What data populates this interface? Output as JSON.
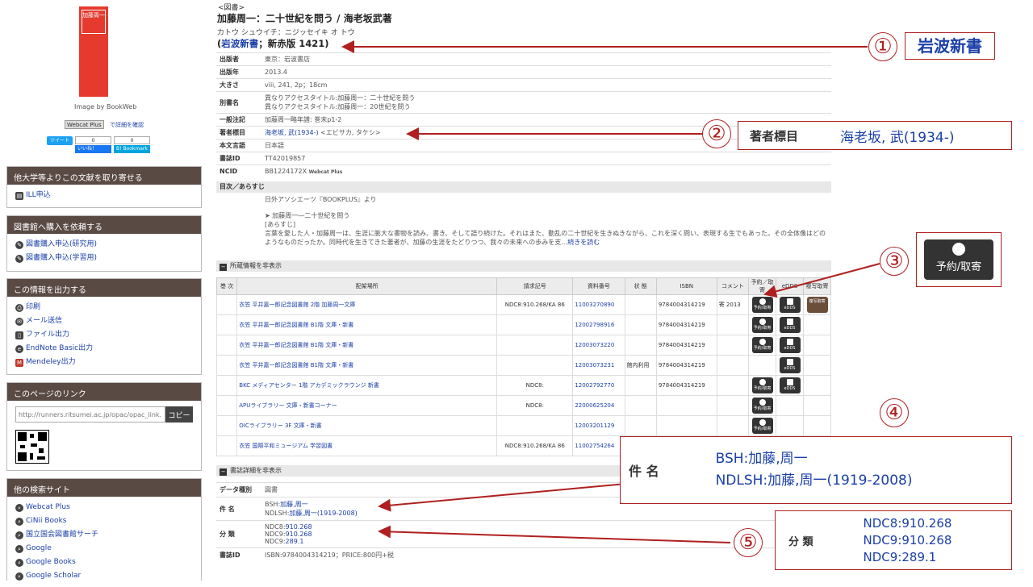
{
  "sidebar": {
    "cover_title": "加藤周一",
    "image_by": "Image by BookWeb",
    "webcat_btn": "Webcat Plus",
    "webcat_detail": "で詳細を確認",
    "tweet": "ツイート",
    "fb_count": "0",
    "fb_like": "いいね！",
    "bm_count": "0",
    "bm_label": "B! Bookmark",
    "sections": [
      {
        "title": "他大学等よりこの文献を取り寄せる",
        "items": [
          {
            "label": "ILL申込",
            "icon": "ill-icon"
          }
        ]
      },
      {
        "title": "図書館へ購入を依頼する",
        "items": [
          {
            "label": "図書購入申込(研究用)",
            "icon": "purchase-research-icon"
          },
          {
            "label": "図書購入申込(学習用)",
            "icon": "purchase-study-icon"
          }
        ]
      },
      {
        "title": "この情報を出力する",
        "items": [
          {
            "label": "印刷",
            "icon": "print-icon"
          },
          {
            "label": "メール送信",
            "icon": "mail-icon"
          },
          {
            "label": "ファイル出力",
            "icon": "file-icon"
          },
          {
            "label": "EndNote Basic出力",
            "icon": "endnote-icon"
          },
          {
            "label": "Mendeley出力",
            "icon": "mendeley-icon"
          }
        ]
      },
      {
        "title": "このページのリンク"
      },
      {
        "title": "他の検索サイト",
        "items": [
          {
            "label": "Webcat Plus",
            "icon": "search-icon"
          },
          {
            "label": "CiNii Books",
            "icon": "search-icon"
          },
          {
            "label": "国立国会図書館サーチ",
            "icon": "search-icon"
          },
          {
            "label": "Google",
            "icon": "search-icon"
          },
          {
            "label": "Google Books",
            "icon": "search-icon"
          },
          {
            "label": "Google Scholar",
            "icon": "search-icon"
          }
        ]
      }
    ],
    "link_url": "http://runners.ritsumei.ac.jp/opac/opac_link...",
    "copy_label": "コピー"
  },
  "record": {
    "type": "<図書>",
    "title": "加藤周一：二十世紀を問う / 海老坂武著",
    "kana": "カトウ シュウイチ：ニジッセイキ オ トウ",
    "series_open": "(",
    "series_link": "岩波新書",
    "series_rest": "；新赤版 1421)",
    "meta": [
      {
        "k": "出版者",
        "v": "東京：岩波書店"
      },
      {
        "k": "出版年",
        "v": "2013.4"
      },
      {
        "k": "大きさ",
        "v": "viii, 241, 2p；18cm"
      },
      {
        "k": "別書名",
        "v": "異なりアクセスタイトル:加藤周一：二十世紀を問う",
        "v2": "異なりアクセスタイトル:加藤周一：20世紀を問う"
      },
      {
        "k": "一般注記",
        "v": "加藤周一略年譜: 巻末p1-2"
      },
      {
        "k": "著者標目",
        "v": "海老坂, 武(1934-)",
        "v_rest": " <エビサカ, タケシ>"
      },
      {
        "k": "本文言語",
        "v": "日本語"
      },
      {
        "k": "書誌ID",
        "v": "TT42019857"
      },
      {
        "k": "NCID",
        "v": "BB1224172X",
        "v_rest": "Webcat Plus"
      }
    ],
    "toc_header": "目次／あらすじ",
    "toc_source": "日外アソシエーツ『BOOKPLUS』より",
    "toc_item": "➤ 加藤周一―二十世紀を問う",
    "toc_arasuji": "[あらすじ]",
    "toc_text1": "言葉を愛した人・加藤周一は、生涯に膨大な書物を読み、書き、そして語り続けた。それはまた、動乱の二十世紀を生きぬきながら、これを深く問い、表現する生でもあった。その全体像はどの",
    "toc_text2": "ようなものだったか。同時代を生きてきた著者が、加藤の生涯をたどりつつ、我々の未来への歩みを支…",
    "toc_more": "続きを読む"
  },
  "holdings": {
    "header": "所蔵情報を非表示",
    "columns": [
      "巻 次",
      "配架場所",
      "請求記号",
      "資料番号",
      "状 態",
      "ISBN",
      "コメント",
      "予約／取寄",
      "eDDS",
      "複写取寄"
    ],
    "rows": [
      {
        "vol": "",
        "loc": "衣笠 平井嘉一郎記念図書館 2階 加藤周一文庫",
        "call": "NDC8:910.268/KA 86",
        "num": "11003270890",
        "status": "",
        "isbn": "9784004314219",
        "comment": "寄 2013",
        "res": true,
        "edds": true,
        "dl": true
      },
      {
        "vol": "",
        "loc": "衣笠 平井嘉一郎記念図書館 B1階 文庫・新書",
        "call": "",
        "num": "12002798916",
        "status": "",
        "isbn": "9784004314219",
        "comment": "",
        "res": true,
        "edds": true,
        "dl": false
      },
      {
        "vol": "",
        "loc": "衣笠 平井嘉一郎記念図書館 B1階 文庫・新書",
        "call": "",
        "num": "12003073220",
        "status": "",
        "isbn": "9784004314219",
        "comment": "",
        "res": true,
        "edds": true,
        "dl": false
      },
      {
        "vol": "",
        "loc": "衣笠 平井嘉一郎記念図書館 B1階 文庫・新書",
        "call": "",
        "num": "12003073231",
        "status": "館内利用",
        "isbn": "9784004314219",
        "comment": "",
        "res": false,
        "edds": true,
        "dl": false
      },
      {
        "vol": "",
        "loc": "BKC メディアセンター 1階 アカデミックラウンジ 新書",
        "call": "NDC8:",
        "num": "12002792770",
        "status": "",
        "isbn": "9784004314219",
        "comment": "",
        "res": true,
        "edds": true,
        "dl": false
      },
      {
        "vol": "",
        "loc": "APUライブラリー 文庫・新書コーナー",
        "call": "NDC8:",
        "num": "22000625204",
        "status": "",
        "isbn": "",
        "comment": "",
        "res": true,
        "edds": false,
        "dl": false
      },
      {
        "vol": "",
        "loc": "OICライブラリー 3F 文庫・新書",
        "call": "",
        "num": "12003201129",
        "status": "",
        "isbn": "",
        "comment": "",
        "res": true,
        "edds": false,
        "dl": false
      },
      {
        "vol": "",
        "loc": "衣笠 国際平和ミュージアム 学習図書",
        "call": "NDC8:910.268/KA 86",
        "num": "11002754264",
        "status": "",
        "isbn": "",
        "comment": "",
        "res": false,
        "edds": false,
        "dl": false
      }
    ],
    "btn_res": "予約/取寄",
    "btn_edds": "eDDS",
    "btn_dl": "複写取寄"
  },
  "bib": {
    "header": "書誌詳細を非表示",
    "rows": [
      {
        "k": "データ種別",
        "lines": [
          {
            "plain": "図書"
          }
        ]
      },
      {
        "k": "件 名",
        "lines": [
          {
            "prefix": "BSH:",
            "link": "加藤,周一"
          },
          {
            "prefix": "NDLSH:",
            "link": "加藤,周一(1919-2008)"
          }
        ]
      },
      {
        "k": "分 類",
        "lines": [
          {
            "prefix": "NDC8:",
            "link": "910.268"
          },
          {
            "prefix": "NDC9:",
            "link": "910.268"
          },
          {
            "prefix": "NDC9:",
            "link": "289.1"
          }
        ]
      },
      {
        "k": "書誌ID",
        "lines": [
          {
            "plain": "ISBN:9784004314219；PRICE:800円+税"
          }
        ]
      }
    ]
  },
  "callouts": [
    {
      "num": "①",
      "k": "",
      "lines": [
        "岩波新書"
      ]
    },
    {
      "num": "②",
      "k": "著者標目",
      "lines": [
        "海老坂, 武(1934-)"
      ]
    },
    {
      "num": "③",
      "k": "",
      "lines": [
        "予約/取寄"
      ]
    },
    {
      "num": "④",
      "k": "件 名",
      "lines": [
        "BSH:加藤,周一",
        "NDLSH:加藤,周一(1919-2008)"
      ]
    },
    {
      "num": "⑤",
      "k": "分 類",
      "lines": [
        "NDC8:910.268",
        "NDC9:910.268",
        "NDC9:289.1"
      ]
    }
  ],
  "colors": {
    "arrow": "#b02020",
    "link": "#1a3fa8",
    "header": "#5a4a44"
  }
}
